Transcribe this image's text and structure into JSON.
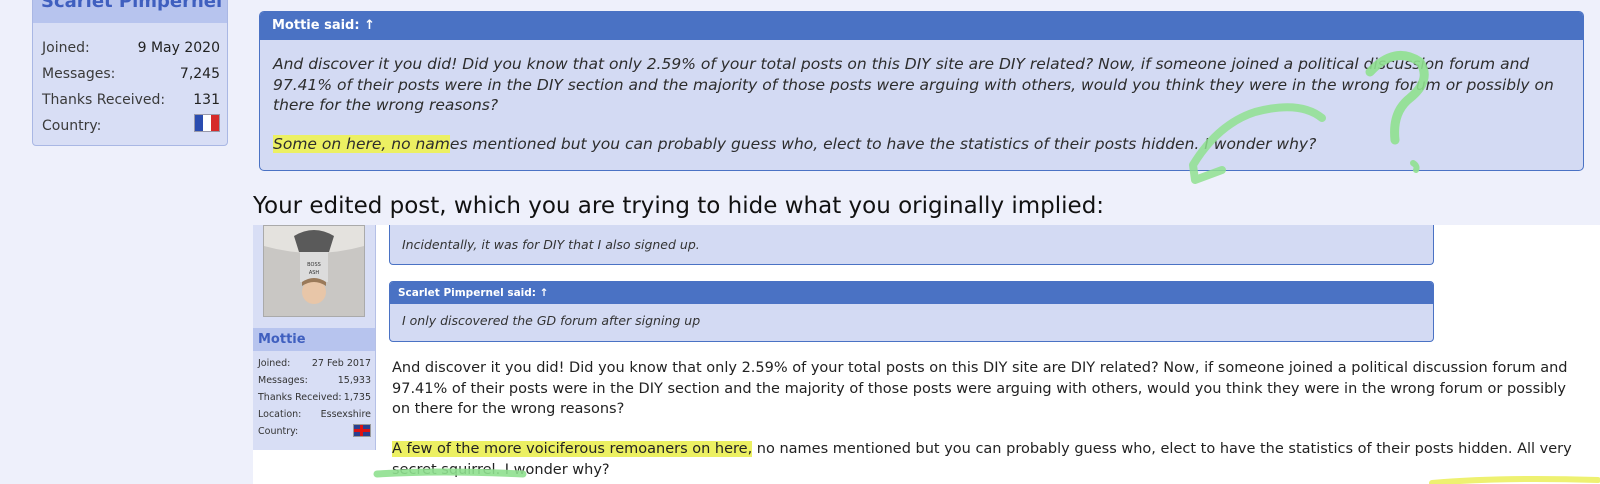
{
  "top_user": {
    "username": "Scarlet Pimpernel",
    "stats": [
      {
        "label": "Joined:",
        "value": "9 May 2020"
      },
      {
        "label": "Messages:",
        "value": "7,245"
      },
      {
        "label": "Thanks Received:",
        "value": "131"
      },
      {
        "label": "Country:",
        "value": ""
      }
    ],
    "flag_icon": "france-flag-icon"
  },
  "top_quote": {
    "header": "Mottie said: ↑",
    "paragraph1": "And discover it you did! Did you know that only 2.59% of your total posts on this DIY site are DIY related? Now, if someone joined a political discussion forum and 97.41% of their posts were in the DIY section and the majority of those posts were arguing with others, would you think they were in the wrong forum or possibly on there for the wrong reasons?",
    "p2_highlight": "Some on here, no nam",
    "p2_rest": "es mentioned but you can probably guess who, elect to have the statistics of their posts hidden. I wonder why?"
  },
  "caption": "Your edited post, which you are trying to hide what you originally implied:",
  "bottom_user": {
    "username": "Mottie",
    "stats": [
      {
        "label": "Joined:",
        "value": "27 Feb 2017"
      },
      {
        "label": "Messages:",
        "value": "15,933"
      },
      {
        "label": "Thanks Received:",
        "value": "1,735"
      },
      {
        "label": "Location:",
        "value": "Essexshire"
      },
      {
        "label": "Country:",
        "value": ""
      }
    ],
    "flag_icon": "uk-flag-icon"
  },
  "snippet": "Incidentally, it was for DIY that I also signed up.",
  "inner_quote": {
    "header": "Scarlet Pimpernel said: ↑",
    "body": "I only discovered the GD forum after signing up"
  },
  "post": {
    "paragraph1": "And discover it you did! Did you know that only 2.59% of your total posts on this DIY site are DIY related? Now, if someone joined a political discussion forum and 97.41% of their posts were in the DIY section and the majority of those posts were arguing with others, would you think they were in the wrong forum or possibly on there for the wrong reasons?",
    "p2_highlight": "A few of the more voiciferous remoaners on here,",
    "p2_rest": " no names mentioned but you can probably guess who, elect to have the statistics of their posts hidden. All very secret squirrel. I wonder why?"
  },
  "colors": {
    "quote_header": "#4a72c4",
    "quote_bg": "#d3daf3",
    "highlight": "#ecf062",
    "annotation_green": "#8fe08f"
  }
}
